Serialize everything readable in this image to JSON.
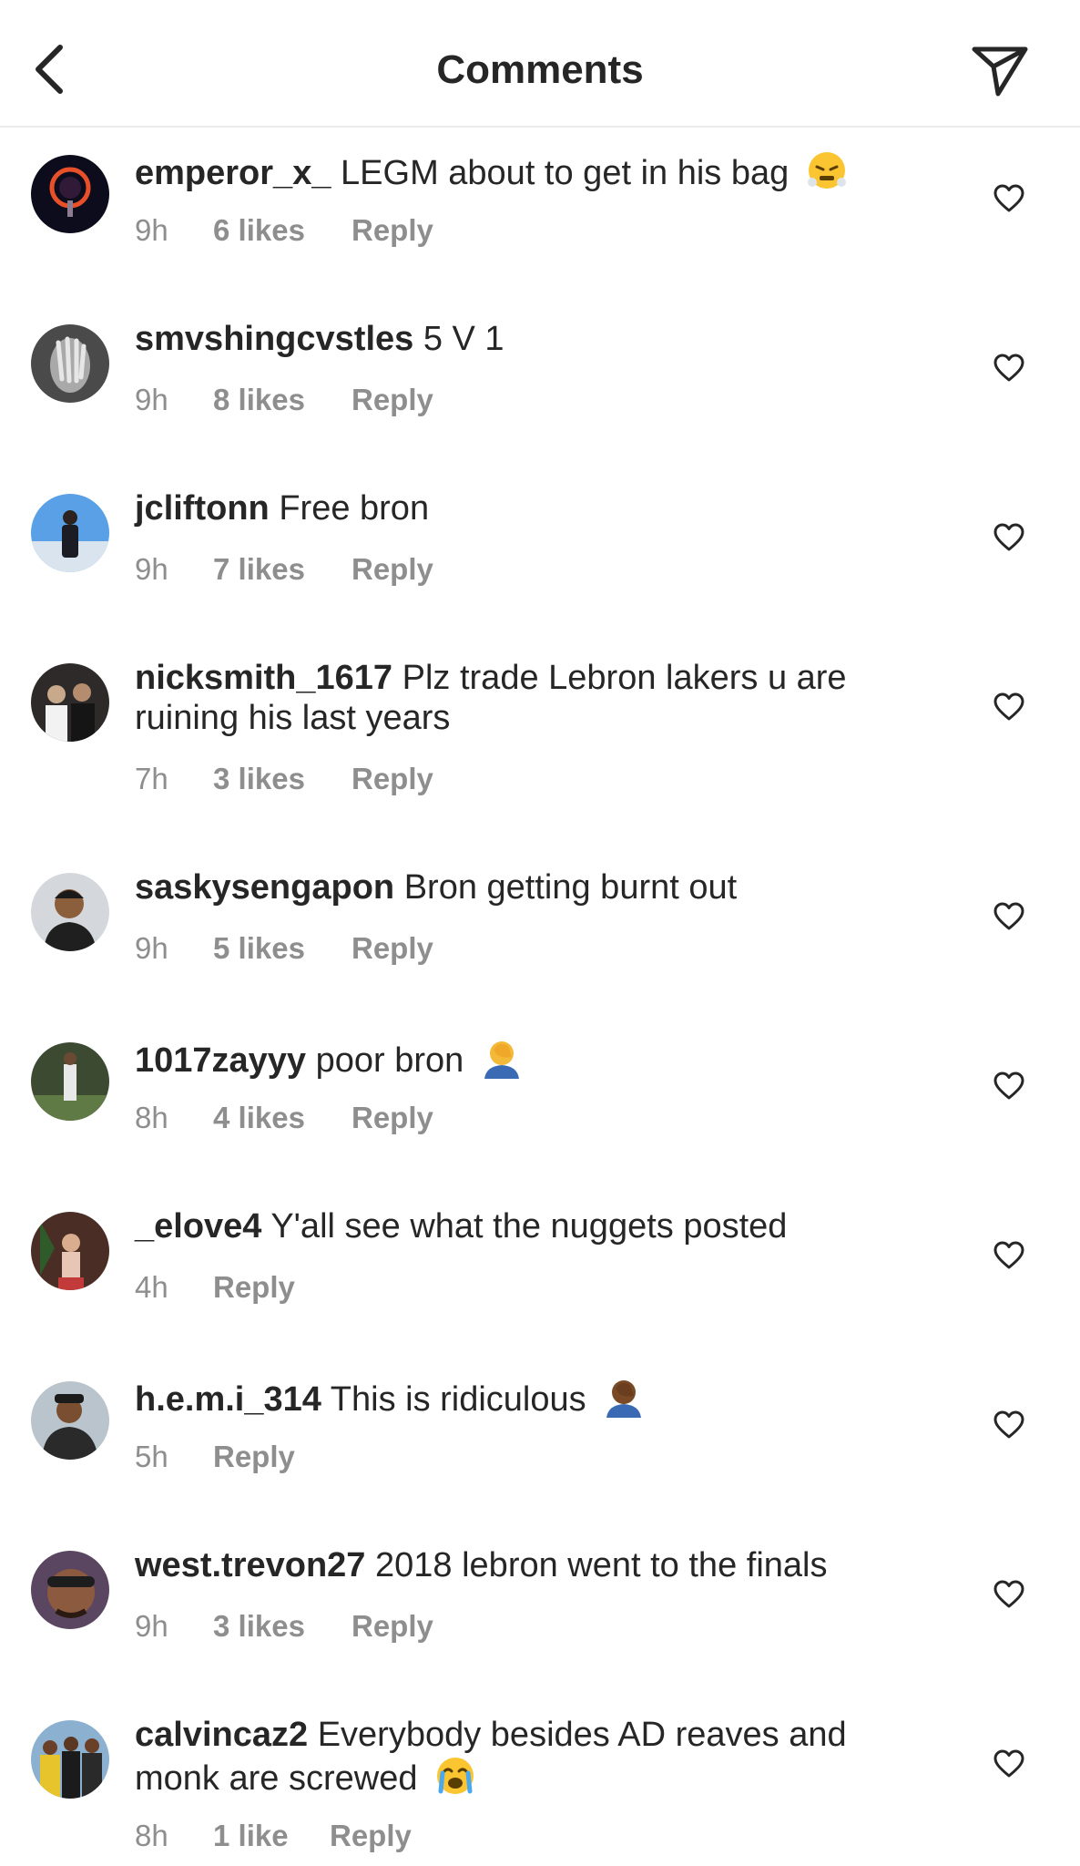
{
  "header": {
    "title": "Comments",
    "back_icon": "chevron-left-icon",
    "share_icon": "paper-plane-icon"
  },
  "colors": {
    "text": "#262626",
    "meta": "#8e8e8e",
    "divider": "#ececec"
  },
  "comments": [
    {
      "username": "emperor_x_",
      "text": "LEGM about to get in his bag",
      "emoji": "face-with-steam-emoji",
      "time": "9h",
      "likes": "6 likes",
      "reply": "Reply"
    },
    {
      "username": "smvshingcvstles",
      "text": "5 V 1",
      "time": "9h",
      "likes": "8 likes",
      "reply": "Reply"
    },
    {
      "username": "jcliftonn",
      "text": "Free bron",
      "time": "9h",
      "likes": "7 likes",
      "reply": "Reply"
    },
    {
      "username": "nicksmith_1617",
      "text": "Plz trade Lebron lakers u are",
      "text2": "ruining his last years",
      "time": "7h",
      "likes": "3 likes",
      "reply": "Reply"
    },
    {
      "username": "saskysengapon",
      "text": "Bron getting burnt out",
      "time": "9h",
      "likes": "5 likes",
      "reply": "Reply"
    },
    {
      "username": "1017zayyy",
      "text": "poor bron",
      "emoji": "facepalm-emoji",
      "time": "8h",
      "likes": "4 likes",
      "reply": "Reply"
    },
    {
      "username": "_elove4",
      "text": "Y'all see what the nuggets posted",
      "time": "4h",
      "reply": "Reply"
    },
    {
      "username": "h.e.m.i_314",
      "text": "This is ridiculous",
      "emoji": "facepalm-emoji",
      "time": "5h",
      "reply": "Reply"
    },
    {
      "username": "west.trevon27",
      "text": "2018 lebron went to the finals",
      "time": "9h",
      "likes": "3 likes",
      "reply": "Reply"
    },
    {
      "username": "calvincaz2",
      "text": "Everybody besides AD reaves and",
      "text2": "monk are screwed",
      "emoji": "loudly-crying-face-emoji",
      "time": "8h",
      "likes": "1 like",
      "reply": "Reply"
    }
  ]
}
